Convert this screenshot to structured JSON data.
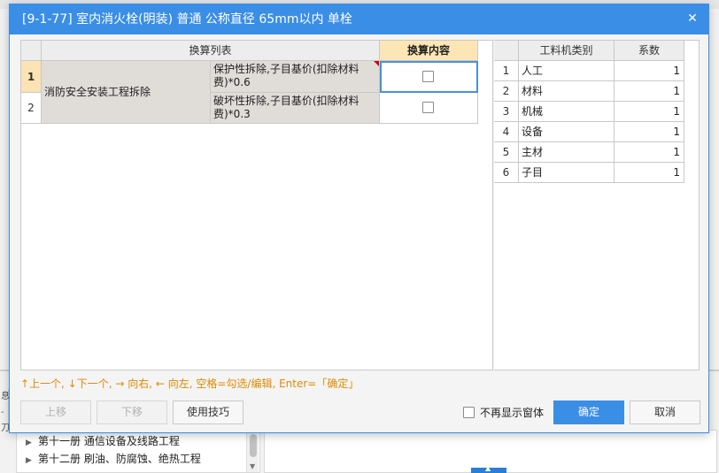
{
  "dialog": {
    "title": "[9-1-77] 室内消火栓(明装) 普通 公称直径 65mm以内 单栓",
    "close_glyph": "✕"
  },
  "left_grid": {
    "header_list": "换算列表",
    "header_content": "换算内容",
    "rows": [
      {
        "num": "1",
        "item": "保护性拆除,子目基价(扣除材料费)*0.6",
        "checked": false
      },
      {
        "num": "2",
        "item": "破坏性拆除,子目基价(扣除材料费)*0.3",
        "checked": false
      }
    ],
    "group_name": "消防安全安装工程拆除"
  },
  "right_grid": {
    "header_type": "工料机类别",
    "header_coef": "系数",
    "rows": [
      {
        "num": "1",
        "name": "人工",
        "value": "1"
      },
      {
        "num": "2",
        "name": "材料",
        "value": "1"
      },
      {
        "num": "3",
        "name": "机械",
        "value": "1"
      },
      {
        "num": "4",
        "name": "设备",
        "value": "1"
      },
      {
        "num": "5",
        "name": "主材",
        "value": "1"
      },
      {
        "num": "6",
        "name": "子目",
        "value": "1"
      }
    ]
  },
  "hint": "↑上一个, ↓下一个, → 向右, ← 向左, 空格=勾选/编辑, Enter=「确定」",
  "buttons": {
    "move_up": "上移",
    "move_down": "下移",
    "tips": "使用技巧",
    "ok": "确定",
    "cancel": "取消"
  },
  "no_show_label": "不再显示窗体",
  "background": {
    "tree_items": [
      "第十一册 通信设备及线路工程",
      "第十二册 刷油、防腐蚀、绝热工程"
    ],
    "left_marks": [
      "息",
      "-刀"
    ]
  },
  "colors": {
    "accent": "#3a8ee6",
    "hint": "#e08a00",
    "active_header": "#fde6b5"
  }
}
